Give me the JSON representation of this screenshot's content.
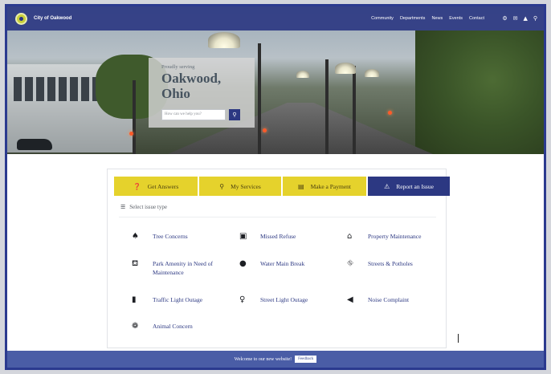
{
  "header": {
    "logo_text": "City of Oakwood",
    "nav": [
      "Community",
      "Departments",
      "News",
      "Events",
      "Contact"
    ],
    "icons": [
      "settings-icon",
      "mail-icon",
      "alert-icon",
      "search-icon"
    ]
  },
  "hero": {
    "subtitle": "Proudly serving",
    "title_line1": "Oakwood,",
    "title_line2": "Ohio",
    "search_placeholder": "How can we help you?"
  },
  "tabs": [
    {
      "label": "Get Answers",
      "icon": "question-icon",
      "glyph": "❓"
    },
    {
      "label": "My Services",
      "icon": "map-pin-icon",
      "glyph": "⚲"
    },
    {
      "label": "Make a Payment",
      "icon": "credit-card-icon",
      "glyph": "▤"
    },
    {
      "label": "Report an Issue",
      "icon": "warning-icon",
      "glyph": "⚠"
    }
  ],
  "issues": {
    "heading": "Select issue type",
    "items": [
      {
        "label": "Tree Concerns",
        "icon": "tree-icon"
      },
      {
        "label": "Missed Refuse",
        "icon": "trash-icon"
      },
      {
        "label": "Property Maintenance",
        "icon": "house-icon"
      },
      {
        "label": "Park Amenity in Need of Maintenance",
        "icon": "park-bench-icon"
      },
      {
        "label": "Water Main Break",
        "icon": "water-drop-icon"
      },
      {
        "label": "Streets & Potholes",
        "icon": "road-icon"
      },
      {
        "label": "Traffic Light Outage",
        "icon": "traffic-light-icon"
      },
      {
        "label": "Street Light Outage",
        "icon": "lightbulb-icon"
      },
      {
        "label": "Noise Complaint",
        "icon": "megaphone-icon"
      },
      {
        "label": "Animal Concern",
        "icon": "paw-icon"
      }
    ]
  },
  "footer": {
    "text": "Welcome to our new website!",
    "button": "Feedback"
  },
  "colors": {
    "nav": "#2c3882",
    "tab_yellow": "#e5d22c",
    "link": "#2c3882",
    "footer": "#4a5da6"
  }
}
